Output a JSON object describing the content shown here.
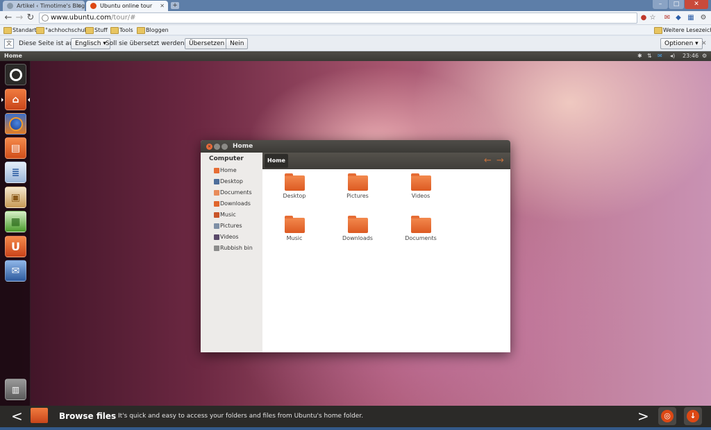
{
  "browser": {
    "tabs": [
      {
        "title": "Artikel ‹ Timotime's Blog –"
      },
      {
        "title": "Ubuntu online tour"
      }
    ],
    "new_tab_symbol": "+",
    "window_controls": {
      "minimize": "–",
      "maximize": "□",
      "close": "✕"
    },
    "url_host": "www.ubuntu.com",
    "url_path": "/tour/#",
    "bookmarks": [
      "Standart",
      "°achhochschule",
      "Stuff",
      "Tools",
      "Bloggen"
    ],
    "other_bookmarks": "Weitere Lesezeichen"
  },
  "translate_bar": {
    "prefix": "Diese Seite ist auf",
    "language": "Englisch",
    "question": "Soll sie übersetzt werden?",
    "translate_button": "Übersetzen",
    "no_button": "Nein",
    "options_button": "Optionen"
  },
  "ubuntu_panel": {
    "title": "Home",
    "time": "23:46"
  },
  "file_manager": {
    "title": "Home",
    "breadcrumb": "Home",
    "sidebar_heading": "Computer",
    "sidebar_items": [
      "Home",
      "Desktop",
      "Documents",
      "Downloads",
      "Music",
      "Pictures",
      "Videos",
      "Rubbish bin"
    ],
    "folders": [
      "Desktop",
      "Pictures",
      "Videos",
      "Music",
      "Downloads",
      "Documents"
    ]
  },
  "tour_bar": {
    "title": "Browse files",
    "description": "It's quick and easy to access your folders and files from Ubuntu's home folder."
  },
  "colors": {
    "ubuntu_orange": "#dd4814",
    "panel_dark": "#3c3b37"
  }
}
